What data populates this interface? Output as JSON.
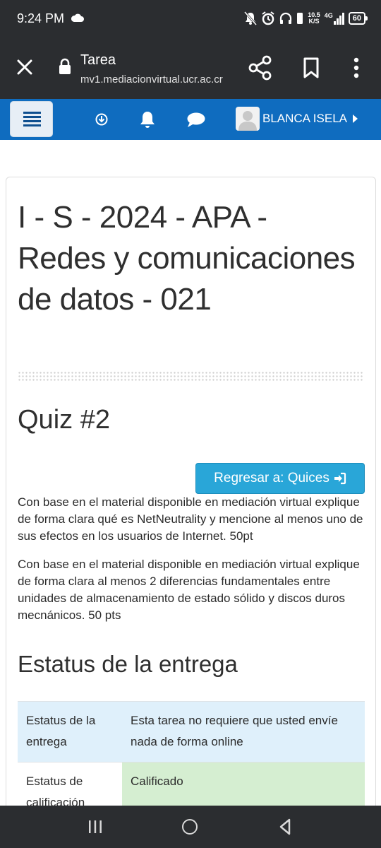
{
  "status_bar": {
    "time": "9:24 PM",
    "net_speed_value": "10.5",
    "net_speed_unit": "K/S",
    "network": "4G",
    "battery": "60",
    "icons": [
      "cloud-icon",
      "mute-icon",
      "alarm-icon",
      "headset-icon",
      "signal-icon",
      "battery-icon"
    ]
  },
  "browser": {
    "title": "Tarea",
    "url": "mv1.mediacionvirtual.ucr.ac.cr",
    "icons": [
      "close-icon",
      "lock-icon",
      "share-icon",
      "bookmark-icon",
      "more-icon"
    ]
  },
  "navbar": {
    "user_name": "BLANCA ISELA",
    "icons": [
      "hamburger-icon",
      "download-icon",
      "bell-icon",
      "chat-icon",
      "avatar",
      "caret-right-icon"
    ],
    "colors": {
      "background": "#0f6cbf"
    }
  },
  "content": {
    "course_title": "I - S - 2024 - APA - Redes y comunicaciones de datos - 021",
    "quiz_title": "Quiz #2",
    "back_button_label": "Regresar a: Quices",
    "instructions": [
      "Con base en el material disponible en mediación virtual explique de forma clara qué es NetNeutrality y mencione al menos uno de sus efectos en los usuarios de Internet. 50pt",
      "Con base en el material disponible en mediación virtual explique de forma clara al menos 2 diferencias fundamentales entre unidades de almacenamiento de estado sólido y discos duros mecnánicos. 50 pts"
    ],
    "status_heading": "Estatus de la entrega",
    "status_table": [
      {
        "label": "Estatus de la entrega",
        "value": "Esta tarea no requiere que usted envíe nada de forma online"
      },
      {
        "label": "Estatus de calificación",
        "value": "Calificado"
      }
    ],
    "colors": {
      "button": "#29a6d8",
      "row_submission": "#dff0fb",
      "row_graded": "#d5eed1"
    }
  },
  "android_nav": {
    "icons": [
      "recent-apps-icon",
      "home-icon",
      "back-icon"
    ]
  }
}
